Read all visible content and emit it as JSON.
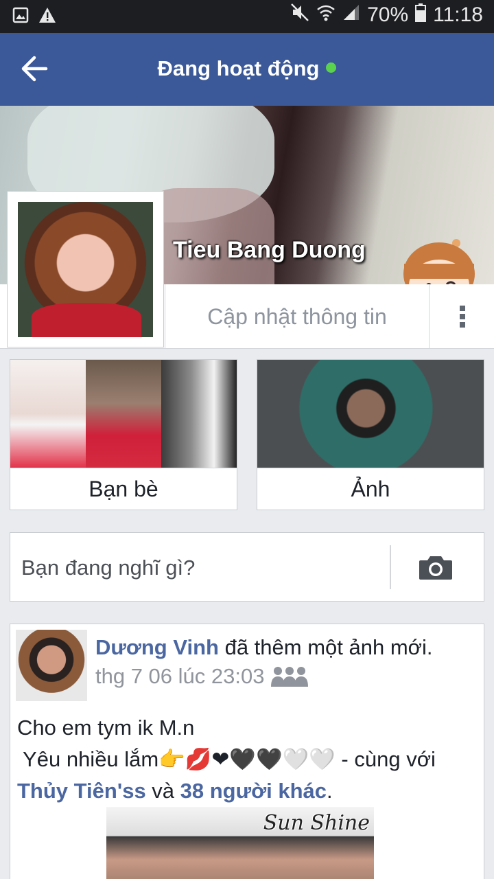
{
  "status_bar": {
    "battery": "70%",
    "time": "11:18",
    "left_icons": [
      "image-icon",
      "warning-icon"
    ],
    "right_icons": [
      "mute-icon",
      "wifi-icon",
      "signal-icon",
      "battery-icon"
    ]
  },
  "header": {
    "title": "Đang hoạt động",
    "online_color": "#5bd24e",
    "bar_color": "#3b5998"
  },
  "profile": {
    "name": "Tieu Bang Duong",
    "update_label": "Cập nhật thông tin"
  },
  "tiles": {
    "friends_label": "Bạn bè",
    "photos_label": "Ảnh"
  },
  "composer": {
    "placeholder": "Bạn đang nghĩ gì?"
  },
  "post": {
    "author": "Dương Vinh",
    "action": " đã thêm một ảnh mới.",
    "timestamp": "thg 7 06 lúc 23:03",
    "line1": "Cho em tym ik M.n",
    "line2": " Yêu nhiều lắm👉💋❤🖤🖤🤍🤍 - cùng với",
    "tag1": "Thủy Tiên'ss",
    "and_text": " và ",
    "tag2": "38 người khác",
    "end": ".",
    "photo_caption": "Sun Shine"
  }
}
